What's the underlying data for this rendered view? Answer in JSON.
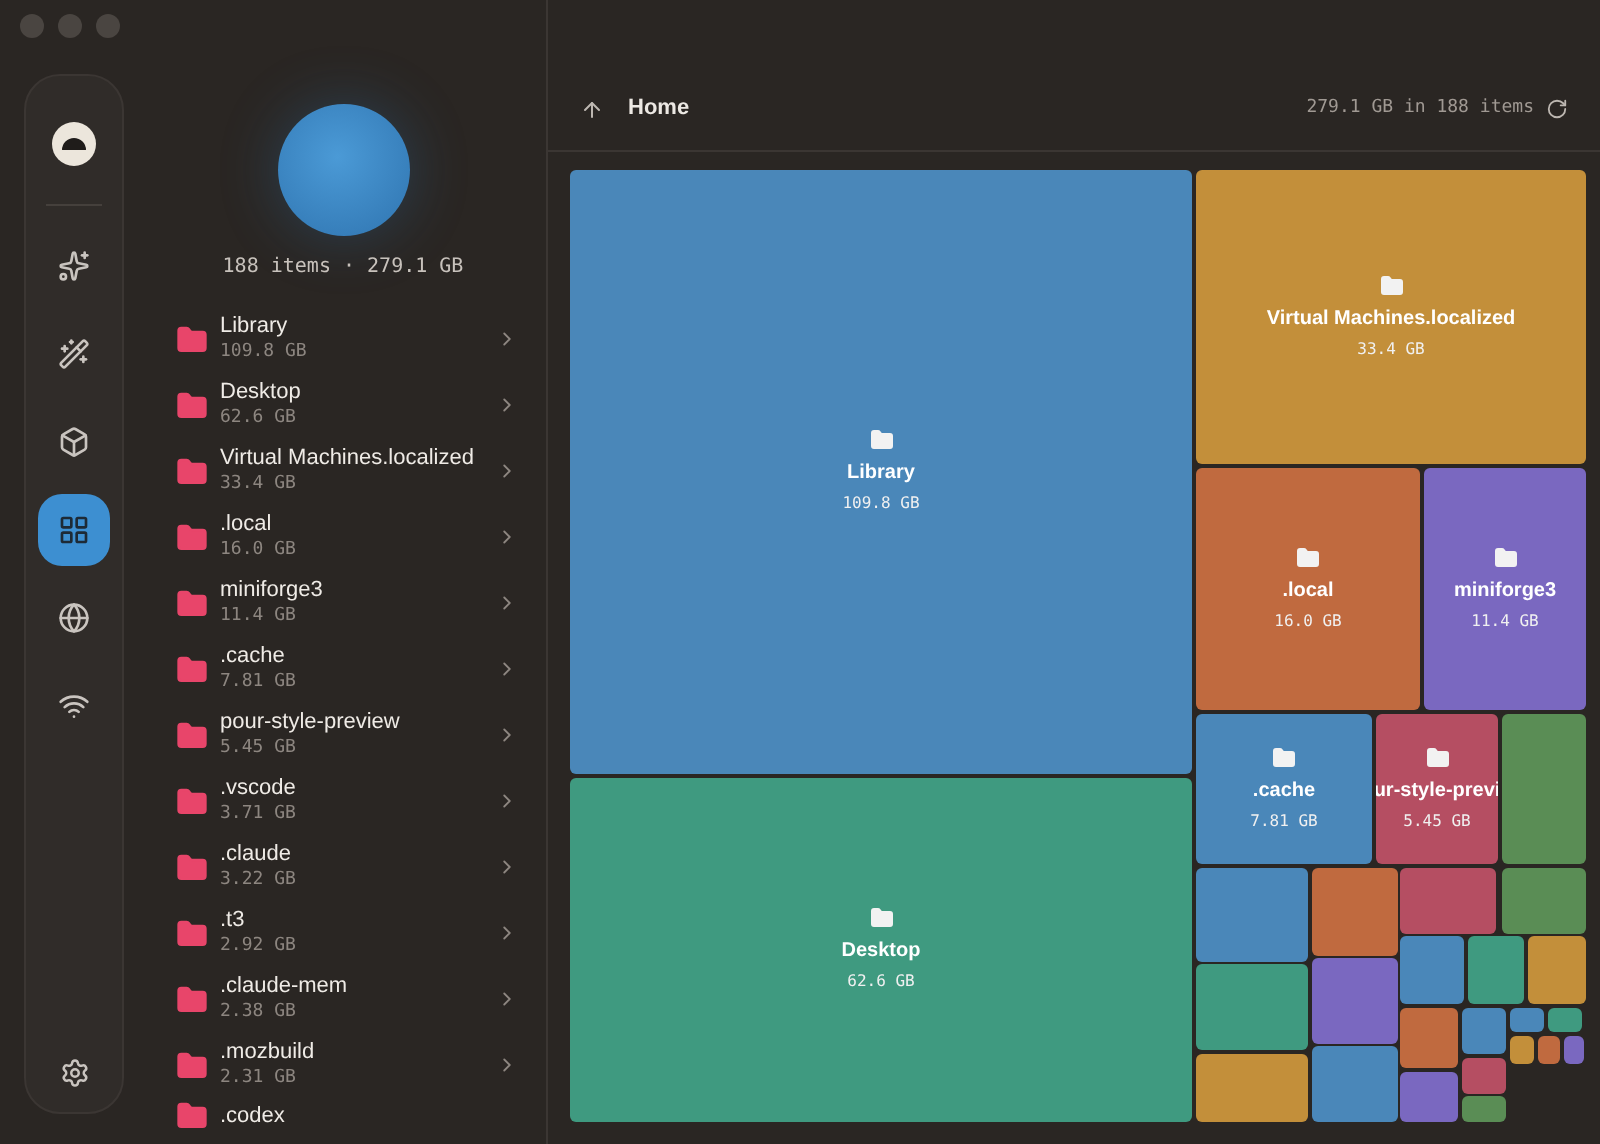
{
  "sidebar": {
    "items": [
      {
        "selected": false
      },
      {
        "selected": false
      },
      {
        "selected": false
      },
      {
        "selected": false
      },
      {
        "selected": true
      },
      {
        "selected": false
      },
      {
        "selected": false
      }
    ]
  },
  "summary": "188 items · 279.1 GB",
  "folders": [
    {
      "name": "Library",
      "size": "109.8 GB"
    },
    {
      "name": "Desktop",
      "size": "62.6 GB"
    },
    {
      "name": "Virtual Machines.localized",
      "size": "33.4 GB"
    },
    {
      "name": ".local",
      "size": "16.0 GB"
    },
    {
      "name": "miniforge3",
      "size": "11.4 GB"
    },
    {
      "name": ".cache",
      "size": "7.81 GB"
    },
    {
      "name": "pour-style-preview",
      "size": "5.45 GB"
    },
    {
      "name": ".vscode",
      "size": "3.71 GB"
    },
    {
      "name": ".claude",
      "size": "3.22 GB"
    },
    {
      "name": ".t3",
      "size": "2.92 GB"
    },
    {
      "name": ".claude-mem",
      "size": "2.38 GB"
    },
    {
      "name": ".mozbuild",
      "size": "2.31 GB"
    },
    {
      "name": ".codex"
    }
  ],
  "header": {
    "title": "Home",
    "total": "279.1 GB in 188 items"
  },
  "treemap": {
    "tiles": [
      {
        "name": "Library",
        "size": "109.8 GB",
        "color": "#4a87b9"
      },
      {
        "name": "Desktop",
        "size": "62.6 GB",
        "color": "#3f9a80"
      },
      {
        "name": "Virtual Machines.localized",
        "size": "33.4 GB",
        "color": "#c38f3a"
      },
      {
        "name": ".local",
        "size": "16.0 GB",
        "color": "#c06a3f"
      },
      {
        "name": "miniforge3",
        "size": "11.4 GB",
        "color": "#7a68c0"
      },
      {
        "name": ".cache",
        "size": "7.81 GB",
        "color": "#4a87b9"
      },
      {
        "name": "ur-style-previ",
        "size": "5.45 GB",
        "color": "#b54e62"
      }
    ],
    "small_tiles": [
      {
        "color": "#5a8d55"
      },
      {
        "color": "#4a87b9"
      },
      {
        "color": "#c06a3f"
      },
      {
        "color": "#b54e62"
      },
      {
        "color": "#5a8d55"
      },
      {
        "color": "#3f9a80"
      },
      {
        "color": "#7a68c0"
      },
      {
        "color": "#c38f3a"
      },
      {
        "color": "#4a87b9"
      },
      {
        "color": "#4a87b9"
      },
      {
        "color": "#3f9a80"
      },
      {
        "color": "#c38f3a"
      },
      {
        "color": "#c06a3f"
      },
      {
        "color": "#7a68c0"
      },
      {
        "color": "#4a87b9"
      },
      {
        "color": "#b54e62"
      },
      {
        "color": "#5a8d55"
      },
      {
        "color": "#4a87b9"
      },
      {
        "color": "#3f9a80"
      },
      {
        "color": "#c38f3a"
      },
      {
        "color": "#c06a3f"
      },
      {
        "color": "#7a68c0"
      }
    ]
  }
}
